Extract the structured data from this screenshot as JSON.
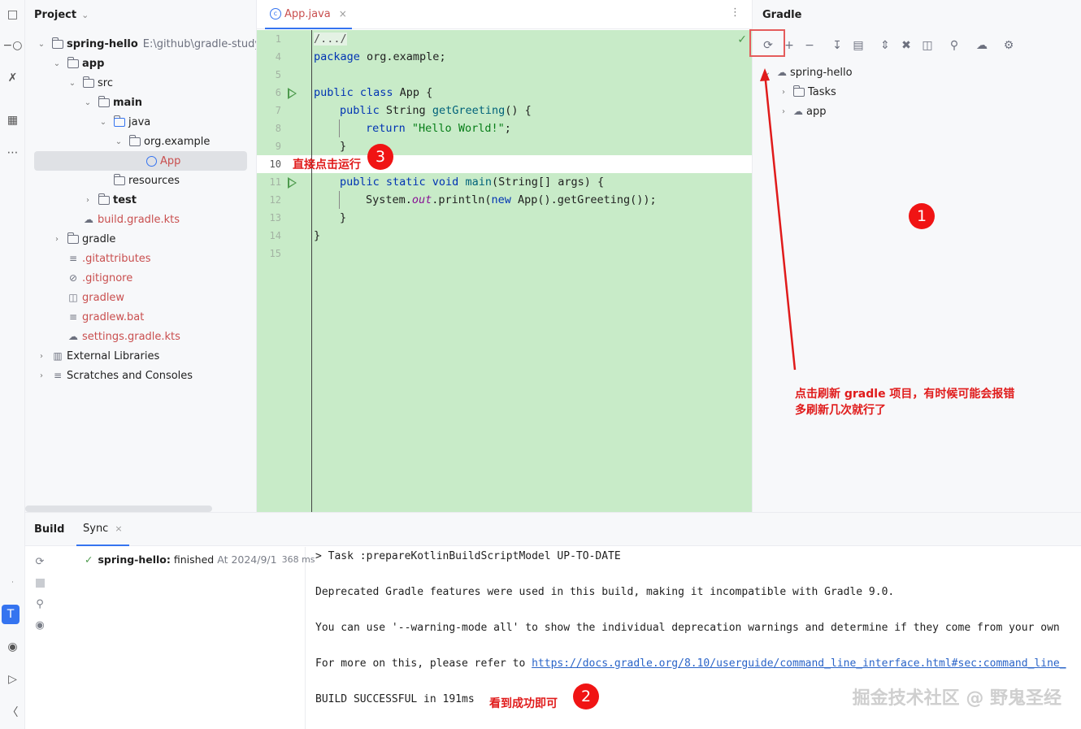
{
  "project": {
    "title": "Project",
    "items": [
      {
        "label": "spring-hello",
        "path": "E:\\github\\gradle-study\\spr"
      },
      {
        "label": "app"
      },
      {
        "label": "src"
      },
      {
        "label": "main"
      },
      {
        "label": "java"
      },
      {
        "label": "org.example"
      },
      {
        "label": "App"
      },
      {
        "label": "resources"
      },
      {
        "label": "test"
      },
      {
        "label": "build.gradle.kts"
      },
      {
        "label": "gradle"
      },
      {
        "label": ".gitattributes"
      },
      {
        "label": ".gitignore"
      },
      {
        "label": "gradlew"
      },
      {
        "label": "gradlew.bat"
      },
      {
        "label": "settings.gradle.kts"
      },
      {
        "label": "External Libraries"
      },
      {
        "label": "Scratches and Consoles"
      }
    ]
  },
  "editor": {
    "tab_label": "App.java",
    "line_numbers": [
      "1",
      "4",
      "5",
      "6",
      "7",
      "8",
      "9",
      "10",
      "11",
      "12",
      "13",
      "14",
      "15"
    ],
    "code": {
      "l1": "/.../",
      "l4_kw": "package",
      "l4_rest": " org.example;",
      "l6_kw": "public class",
      "l6_rest": " App {",
      "l7_kw": "public",
      "l7_type": " String ",
      "l7_fn": "getGreeting",
      "l7_rest": "() {",
      "l8_kw": "return",
      "l8_str": "\"Hello World!\"",
      "l8_rest": ";",
      "l9": "}",
      "l11_kw": "public static void",
      "l11_fn": "main",
      "l11_rest": "(String[] args) {",
      "l12_a": "System.",
      "l12_it": "out",
      "l12_b": ".println(",
      "l12_kw": "new",
      "l12_c": " App().getGreeting());",
      "l13": "}",
      "l14": "}"
    }
  },
  "gradle": {
    "title": "Gradle",
    "tree": [
      {
        "label": "spring-hello"
      },
      {
        "label": "Tasks"
      },
      {
        "label": "app"
      }
    ]
  },
  "annotations": {
    "a1_badge": "1",
    "a1_text_line1": "点击刷新 gradle 项目，有时候可能会报错",
    "a1_text_line2": "多刷新几次就行了",
    "a2_badge": "2",
    "a2_text": "看到成功即可",
    "a3_badge": "3",
    "a3_text": "直接点击运行",
    "color": "#e01b1b"
  },
  "bottom": {
    "tab_build": "Build",
    "tab_sync": "Sync",
    "sync_name": "spring-hello:",
    "sync_status": "finished",
    "sync_time": "At 2024/9/1",
    "sync_duration": "368 ms",
    "console": {
      "line1": "> Task :prepareKotlinBuildScriptModel UP-TO-DATE",
      "line2": "Deprecated Gradle features were used in this build, making it incompatible with Gradle 9.0.",
      "line3": "You can use '--warning-mode all' to show the individual deprecation warnings and determine if they come from your own",
      "line4_prefix": "For more on this, please refer to ",
      "line4_link": "https://docs.gradle.org/8.10/userguide/command_line_interface.html#sec:command_line_",
      "line5": "BUILD SUCCESSFUL in 191ms"
    }
  },
  "watermark": "掘金技术社区 @ 野鬼圣经",
  "colors": {
    "accent": "#3574f0",
    "editor_highlight": "#c8ebc8",
    "success": "#4d9a4d",
    "error_red": "#c94f4f"
  }
}
